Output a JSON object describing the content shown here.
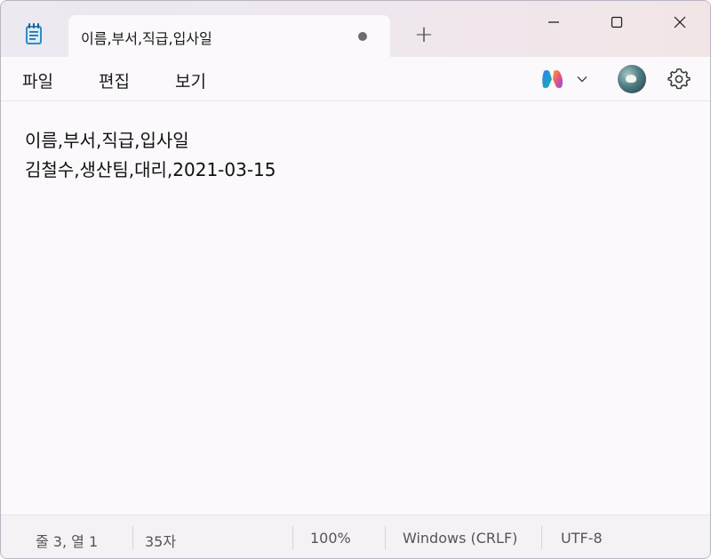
{
  "tab": {
    "title": "이름,부서,직급,입사일",
    "unsaved_indicator": "●",
    "new_tab_label": "+"
  },
  "menu": {
    "file": "파일",
    "edit": "편집",
    "view": "보기"
  },
  "editor": {
    "lines": [
      "이름,부서,직급,입사일",
      "김철수,생산팀,대리,2021-03-15"
    ]
  },
  "statusbar": {
    "position": "줄 3, 열 1",
    "char_count": "35자",
    "zoom": "100%",
    "line_ending": "Windows (CRLF)",
    "encoding": "UTF-8"
  },
  "icons": {
    "app": "notepad-icon",
    "copilot": "copilot-icon",
    "settings": "gear-icon",
    "profile": "avatar"
  },
  "colors": {
    "titlebar": "#ece9f0",
    "editor_bg": "#fbf9fb",
    "statusbar_bg": "#f5f2f5"
  }
}
